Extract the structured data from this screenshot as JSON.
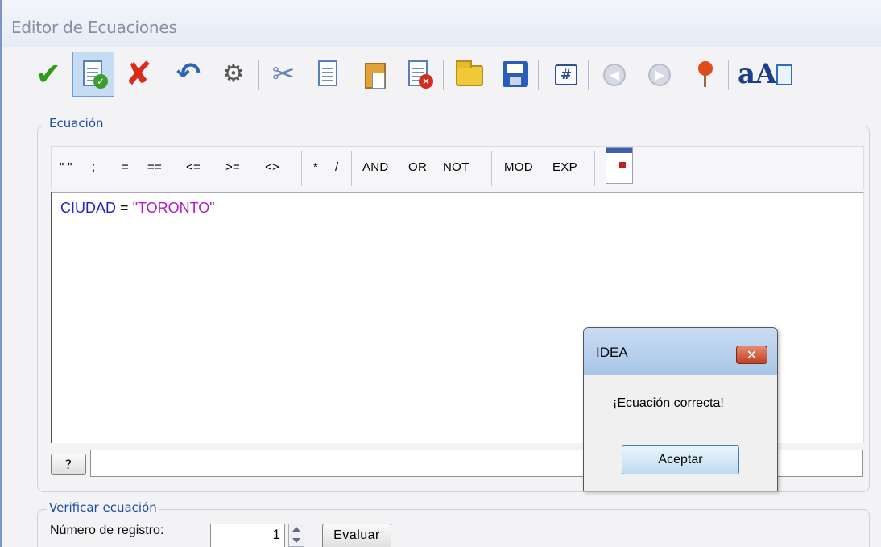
{
  "window": {
    "title": "Editor de Ecuaciones"
  },
  "toolbar": {
    "icons": [
      "check-icon",
      "validate-doc-icon",
      "cancel-icon",
      "undo-icon",
      "find-icon",
      "cut-icon",
      "copy-icon",
      "paste-icon",
      "delete-doc-icon",
      "open-folder-icon",
      "save-icon",
      "number-format-icon",
      "back-icon",
      "forward-icon",
      "pin-icon",
      "font-icon",
      "panel-icon"
    ],
    "hash_label": "#",
    "back_label": "◀",
    "forward_label": "▶",
    "font_label": "aA"
  },
  "equation": {
    "group_label": "Ecuación",
    "operators": {
      "quotes": "\" \"",
      "semicolon": ";",
      "eq": "=",
      "eqeq": "==",
      "le": "<=",
      "ge": ">=",
      "ne": "<>",
      "mul": "*",
      "div": "/",
      "and": "AND",
      "or": "OR",
      "not": "NOT",
      "mod": "MOD",
      "exp": "EXP"
    },
    "code": {
      "field": "CIUDAD",
      "operator": "=",
      "value": "\"TORONTO\""
    },
    "help_button": "?",
    "message_value": ""
  },
  "verify": {
    "group_label": "Verificar ecuación",
    "record_label": "Número de registro:",
    "record_value": "1",
    "evaluate_button": "Evaluar"
  },
  "dialog": {
    "title": "IDEA",
    "close_label": "✕",
    "message": "¡Ecuación correcta!",
    "ok_button": "Aceptar"
  },
  "colors": {
    "keyword": "#2222cc",
    "string": "#b21ac8",
    "accent": "#1f4ca8"
  }
}
